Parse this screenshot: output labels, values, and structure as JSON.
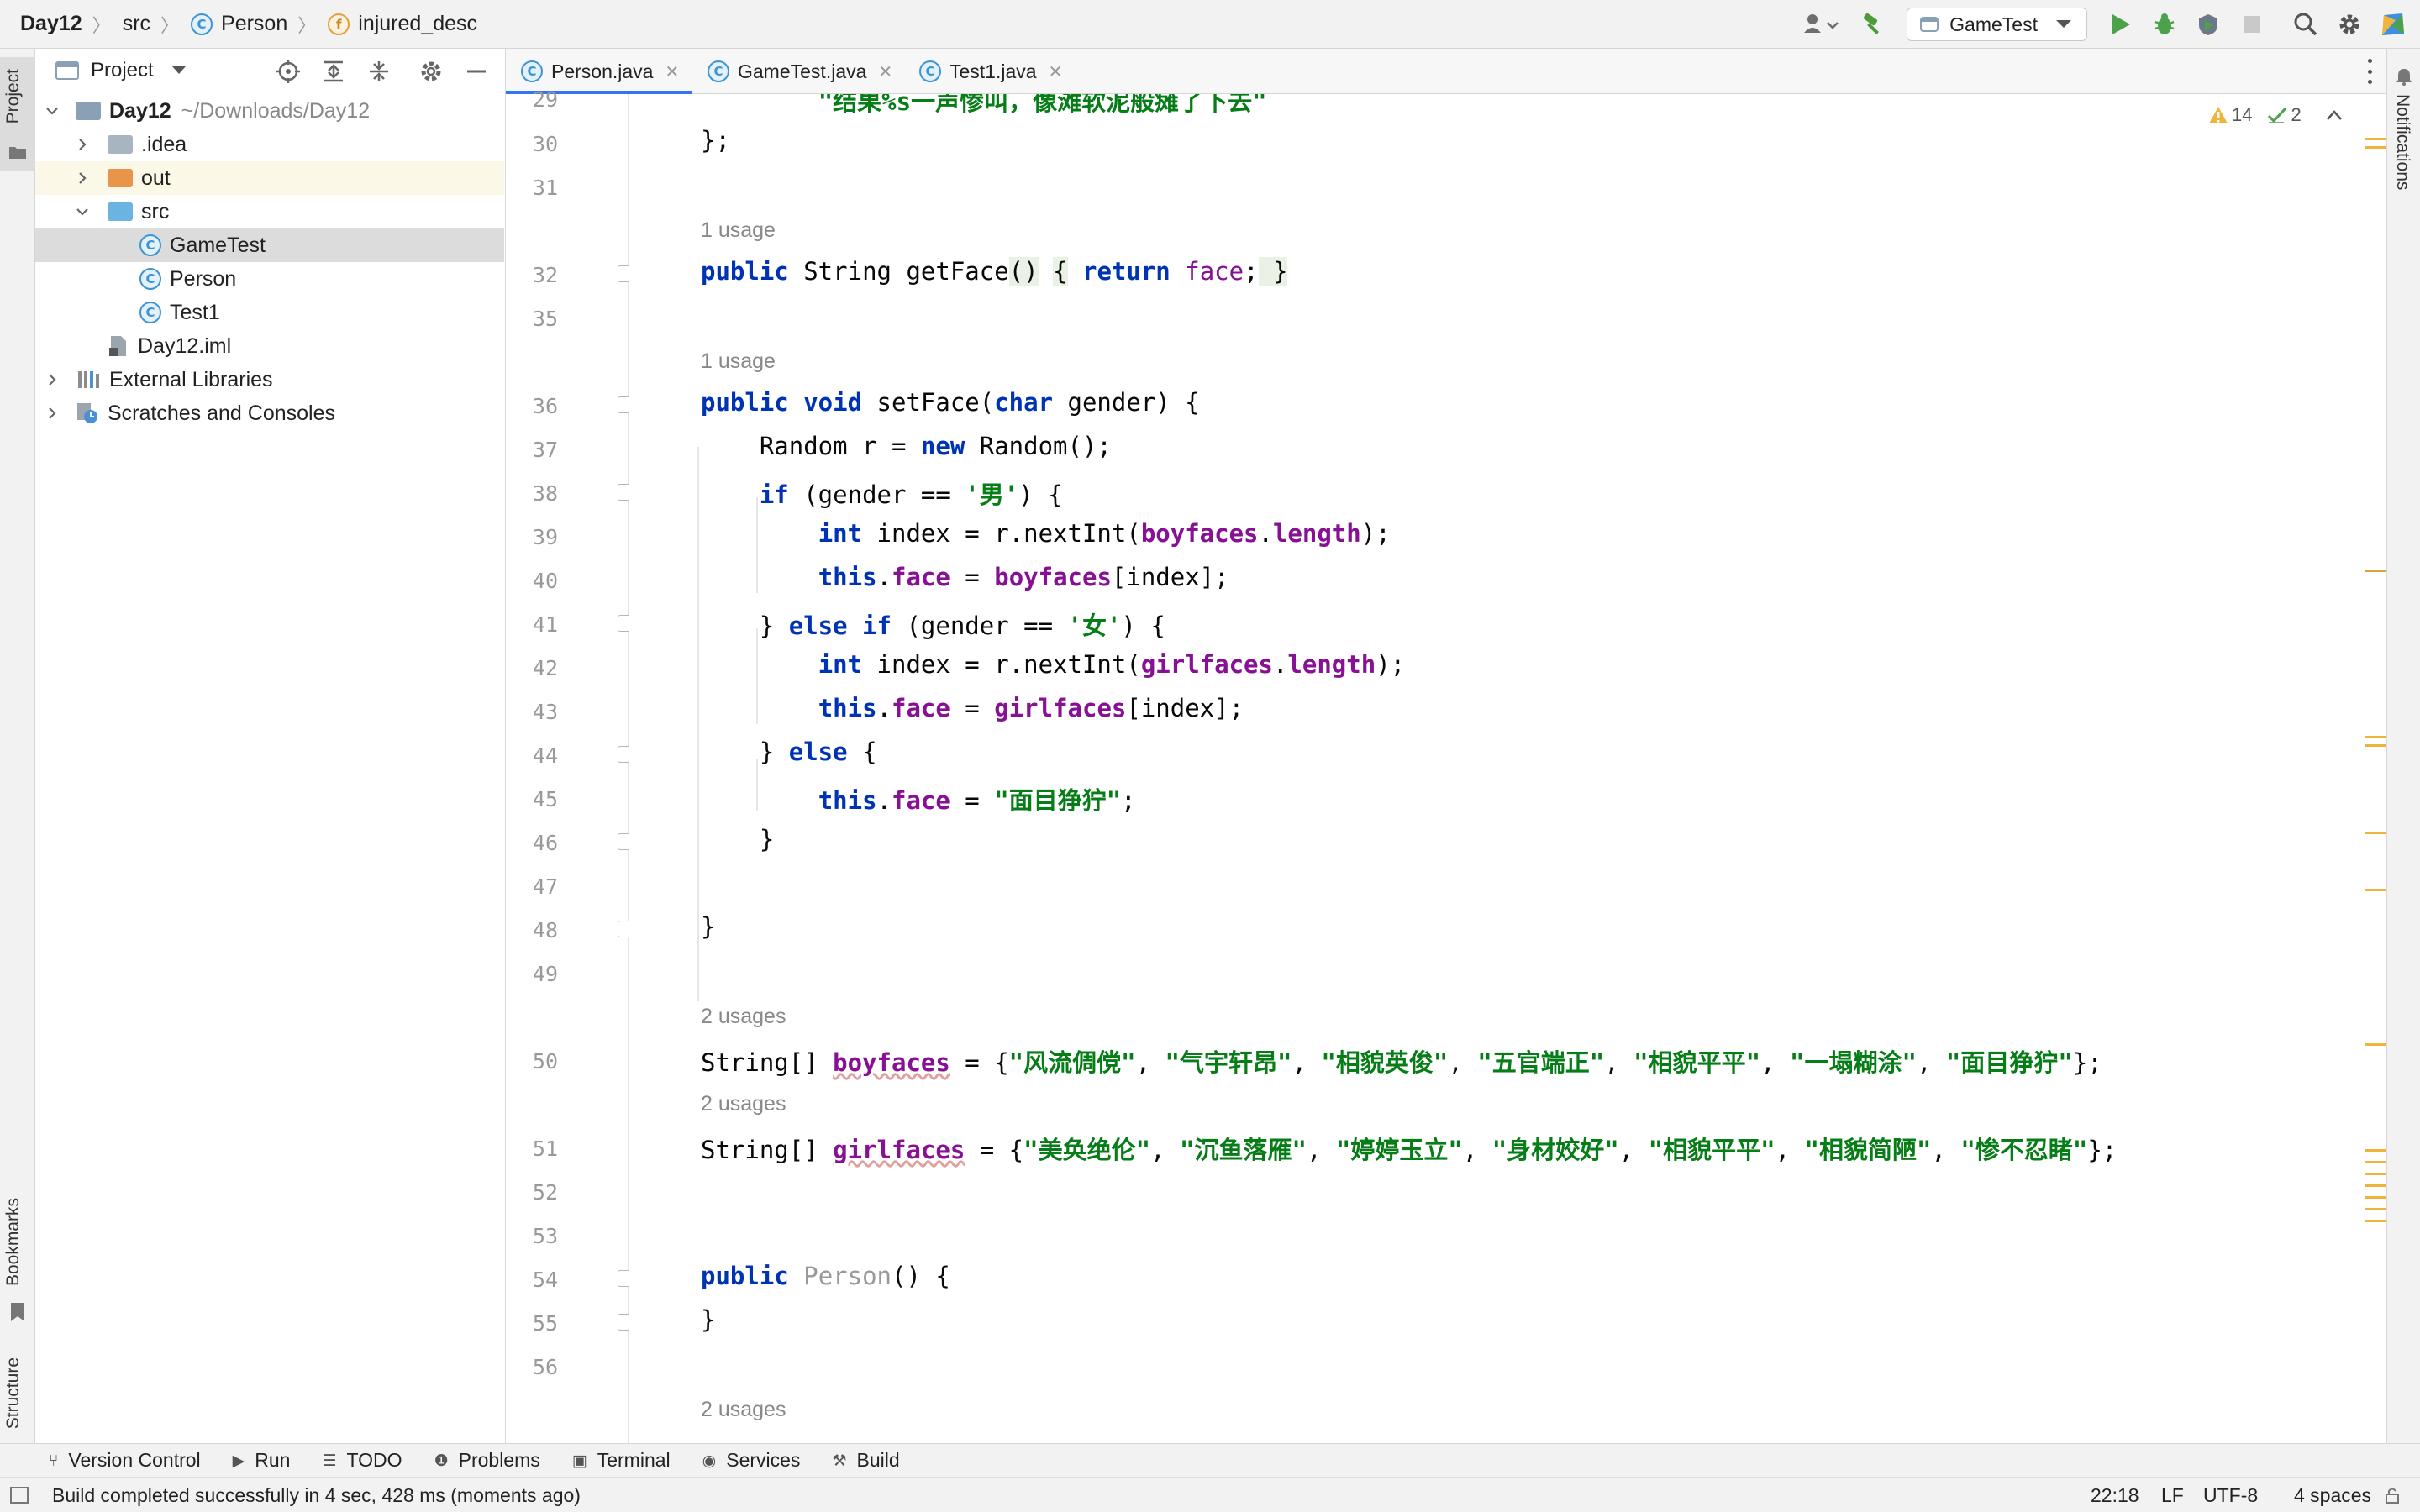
{
  "breadcrumb": {
    "project": "Day12",
    "folder": "src",
    "class": "Person",
    "field": "injured_desc"
  },
  "toolbar": {
    "run_config": "GameTest"
  },
  "project_panel": {
    "title": "Project",
    "root_name": "Day12",
    "root_path": "~/Downloads/Day12",
    "items": [
      "Day12",
      ".idea",
      "out",
      "src",
      "GameTest",
      "Person",
      "Test1",
      "Day12.iml",
      "External Libraries",
      "Scratches and Consoles"
    ]
  },
  "left_strip": {
    "project": "Project",
    "bookmarks": "Bookmarks",
    "structure": "Structure"
  },
  "right_strip": {
    "notifications": "Notifications"
  },
  "tabs": [
    "Person.java",
    "GameTest.java",
    "Test1.java"
  ],
  "inspections": {
    "warnings": "14",
    "weak_warnings": "2"
  },
  "editor": {
    "partial_line": "\"结果%s一声惨叫，像滩软泥般瘫了下去\"",
    "line_numbers": [
      "29",
      "30",
      "31",
      "32",
      "35",
      "36",
      "37",
      "38",
      "39",
      "40",
      "41",
      "42",
      "43",
      "44",
      "45",
      "46",
      "47",
      "48",
      "49",
      "50",
      "51",
      "52",
      "53",
      "54",
      "55",
      "56"
    ],
    "usage_1": "1 usage",
    "usage_2": "2 usages",
    "boyfaces": [
      "风流倜傥",
      "气宇轩昂",
      "相貌英俊",
      "五官端正",
      "相貌平平",
      "一塌糊涂",
      "面目狰狞"
    ],
    "girlfaces": [
      "美奂绝伦",
      "沉鱼落雁",
      "婷婷玉立",
      "身材姣好",
      "相貌平平",
      "相貌简陋",
      "惨不忍睹"
    ],
    "gender_male": "'男'",
    "gender_female": "'女'",
    "default_face": "\"面目狰狞\""
  },
  "bottom_tools": [
    "Version Control",
    "Run",
    "TODO",
    "Problems",
    "Terminal",
    "Services",
    "Build"
  ],
  "status": {
    "message": "Build completed successfully in 4 sec, 428 ms (moments ago)",
    "position": "22:18",
    "line_ending": "LF",
    "encoding": "UTF-8",
    "indent": "4 spaces"
  }
}
